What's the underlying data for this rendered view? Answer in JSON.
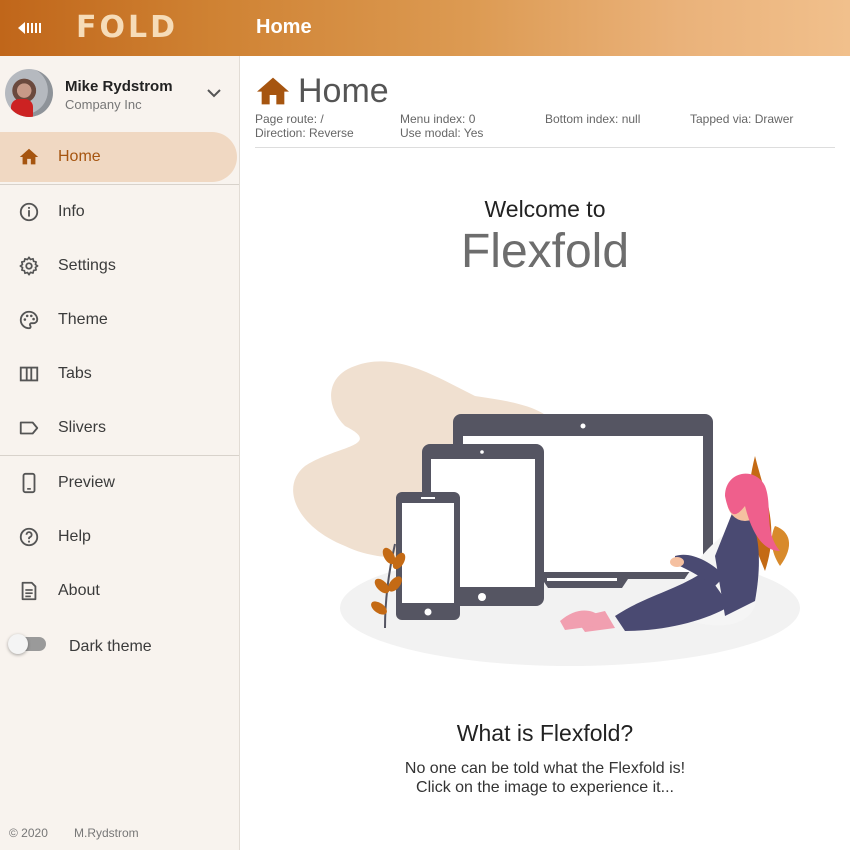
{
  "app": {
    "logo_text": "FOLD",
    "title": "Home",
    "gradient": [
      "#c0661a",
      "#f1c08c"
    ]
  },
  "user": {
    "name": "Mike Rydstrom",
    "company": "Company Inc"
  },
  "nav": {
    "items": [
      {
        "label": "Home",
        "icon": "home-icon",
        "active": true
      },
      {
        "label": "Info",
        "icon": "info-icon"
      },
      {
        "label": "Settings",
        "icon": "gear-icon"
      },
      {
        "label": "Theme",
        "icon": "palette-icon"
      },
      {
        "label": "Tabs",
        "icon": "columns-icon"
      },
      {
        "label": "Slivers",
        "icon": "label-icon"
      },
      {
        "label": "Preview",
        "icon": "phone-icon"
      },
      {
        "label": "Help",
        "icon": "help-icon"
      },
      {
        "label": "About",
        "icon": "document-icon"
      }
    ],
    "dark_theme_label": "Dark theme",
    "dark_theme_on": false
  },
  "footer": {
    "copyright": "© 2020",
    "author": "M.Rydstrom"
  },
  "page": {
    "title": "Home",
    "info": {
      "route": "Page route: /",
      "direction": "Direction: Reverse",
      "menu_index": "Menu index: 0",
      "use_modal": "Use modal: Yes",
      "bottom_index": "Bottom index: null",
      "tapped_via": "Tapped via: Drawer"
    },
    "welcome_line1": "Welcome to",
    "welcome_line2": "Flexfold",
    "question": "What is Flexfold?",
    "desc_line1": "No one can be told what the Flexfold is!",
    "desc_line2": "Click on the image to experience it..."
  },
  "colors": {
    "accent": "#a65510",
    "active_bg": "#f0d8c2",
    "drawer_bg": "#f8f3ee"
  }
}
